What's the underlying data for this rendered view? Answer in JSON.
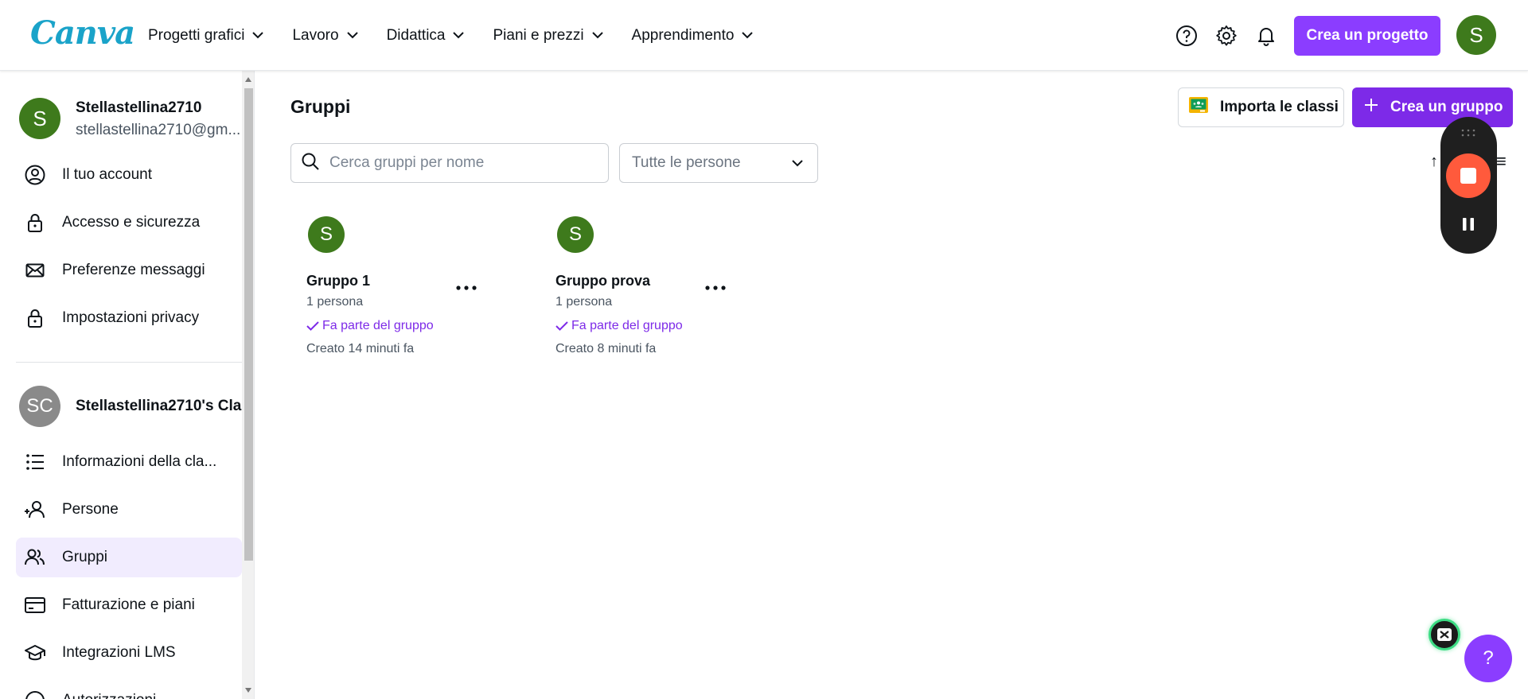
{
  "app": {
    "logo": "Canva"
  },
  "nav": [
    {
      "label": "Progetti grafici"
    },
    {
      "label": "Lavoro"
    },
    {
      "label": "Didattica"
    },
    {
      "label": "Piani e prezzi"
    },
    {
      "label": "Apprendimento"
    }
  ],
  "header": {
    "create_project_label": "Crea un progetto",
    "avatar_initial": "S",
    "icons": [
      "help-circle-icon",
      "gear-icon",
      "bell-icon"
    ]
  },
  "sidebar": {
    "user": {
      "initial": "S",
      "name": "Stellastellina2710",
      "email": "stellastellina2710@gm..."
    },
    "account_items": [
      {
        "label": "Il tuo account",
        "icon": "user-circle-icon"
      },
      {
        "label": "Accesso e sicurezza",
        "icon": "lock-icon"
      },
      {
        "label": "Preferenze messaggi",
        "icon": "envelope-icon"
      },
      {
        "label": "Impostazioni privacy",
        "icon": "lock-icon"
      }
    ],
    "team": {
      "initials": "SC",
      "name": "Stellastellina2710's Cla..."
    },
    "team_items": [
      {
        "label": "Informazioni della cla...",
        "icon": "list-icon"
      },
      {
        "label": "Persone",
        "icon": "add-person-icon"
      },
      {
        "label": "Gruppi",
        "icon": "people-icon",
        "active": true
      },
      {
        "label": "Fatturazione e piani",
        "icon": "credit-card-icon"
      },
      {
        "label": "Integrazioni LMS",
        "icon": "graduation-cap-icon"
      },
      {
        "label": "Autorizzazioni",
        "icon": "key-icon"
      }
    ]
  },
  "main": {
    "title": "Gruppi",
    "import_label": "Importa le classi",
    "create_group_label": "Crea un gruppo",
    "search_placeholder": "Cerca gruppi per nome",
    "filter_selected": "Tutte le persone",
    "groups": [
      {
        "initial": "S",
        "name": "Gruppo 1",
        "count": "1 persona",
        "membership": "Fa parte del gruppo",
        "created": "Creato 14 minuti fa"
      },
      {
        "initial": "S",
        "name": "Gruppo prova",
        "count": "1 persona",
        "membership": "Fa parte del gruppo",
        "created": "Creato 8 minuti fa"
      }
    ]
  },
  "floating": {
    "help_label": "?"
  },
  "colors": {
    "accent": "#8b3dff",
    "avatar_green": "#3e7a1c",
    "recorder_stop": "#ff5a3c"
  }
}
